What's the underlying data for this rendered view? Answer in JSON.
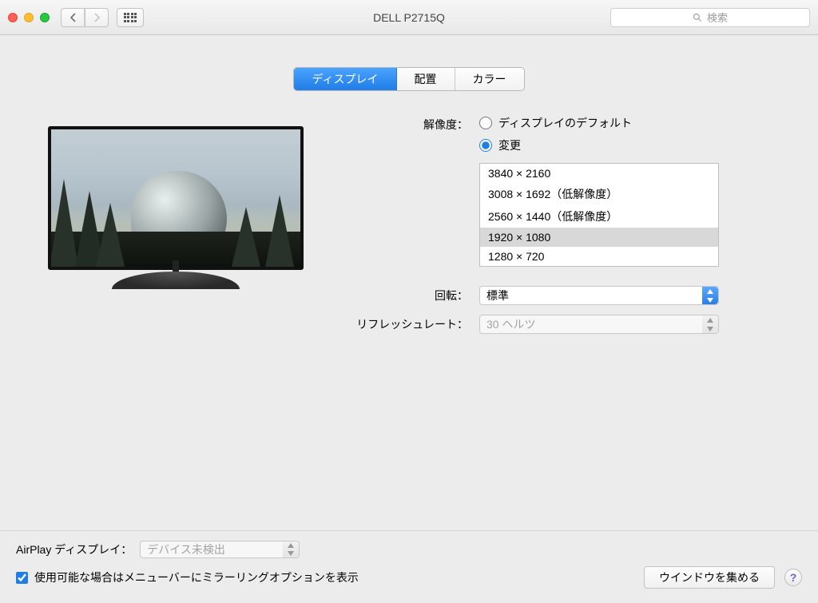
{
  "window": {
    "title": "DELL P2715Q"
  },
  "search": {
    "placeholder": "検索"
  },
  "tabs": {
    "display": "ディスプレイ",
    "arrange": "配置",
    "color": "カラー"
  },
  "labels": {
    "resolution": "解像度：",
    "rotation": "回転：",
    "refresh": "リフレッシュレート：",
    "airplay": "AirPlay ディスプレイ："
  },
  "radios": {
    "default": "ディスプレイのデフォルト",
    "scaled": "変更"
  },
  "resolutions": [
    "3840 × 2160",
    "3008 × 1692（低解像度）",
    "2560 × 1440（低解像度）",
    "1920 × 1080",
    "1280 × 720"
  ],
  "selected_resolution_index": 3,
  "rotation_value": "標準",
  "refresh_value": "30 ヘルツ",
  "airplay_value": "デバイス未検出",
  "mirror_checkbox": "使用可能な場合はメニューバーにミラーリングオプションを表示",
  "gather_button": "ウインドウを集める",
  "help": "?"
}
